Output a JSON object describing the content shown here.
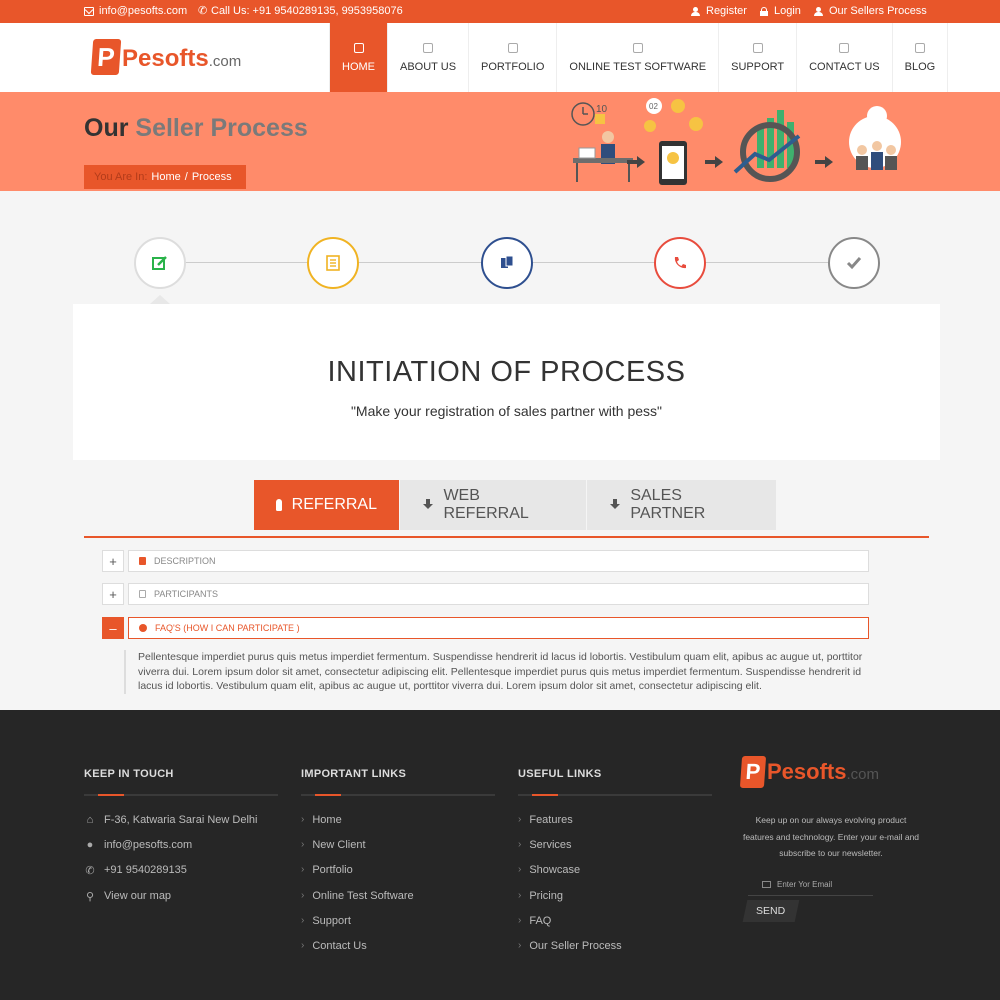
{
  "topbar": {
    "email": "info@pesofts.com",
    "call": "Call Us: +91 9540289135, 9953958076",
    "register": "Register",
    "login": "Login",
    "sellers": "Our Sellers Process"
  },
  "logo": {
    "mark": "P",
    "name": "Pesofts",
    "tld": ".com"
  },
  "nav": [
    "HOME",
    "ABOUT US",
    "PORTFOLIO",
    "ONLINE TEST SOFTWARE",
    "SUPPORT",
    "CONTACT US",
    "BLOG"
  ],
  "banner": {
    "title_a": "Our",
    "title_b": "Seller Process",
    "crumb_label": "You Are In:",
    "crumb_home": "Home",
    "crumb_sep": "/",
    "crumb_current": "Process",
    "illus_num1": "10",
    "illus_num2": "02"
  },
  "steps": [
    {
      "icon": "edit-icon",
      "color": "#2ab34a"
    },
    {
      "icon": "list-icon",
      "color": "#f0b322"
    },
    {
      "icon": "copy-icon",
      "color": "#2e4f8f"
    },
    {
      "icon": "phone-icon",
      "color": "#e84c3d"
    },
    {
      "icon": "check-icon",
      "color": "#888888"
    }
  ],
  "card": {
    "title": "INITIATION OF PROCESS",
    "subtitle": "\"Make your registration of sales partner with pess\""
  },
  "tabs": [
    "REFERRAL",
    "WEB REFERRAL",
    "SALES PARTNER"
  ],
  "accordion": [
    {
      "label": "DESCRIPTION",
      "toggle": "+"
    },
    {
      "label": "PARTICIPANTS",
      "toggle": "+"
    },
    {
      "label": "FAQ'S (HOW I CAN PARTICIPATE )",
      "toggle": "–"
    }
  ],
  "accordion_body": "Pellentesque imperdiet purus quis metus imperdiet fermentum. Suspendisse hendrerit id lacus id lobortis. Vestibulum quam elit, apibus ac augue ut, porttitor viverra dui. Lorem ipsum dolor sit amet, consectetur adipiscing elit. Pellentesque imperdiet purus quis metus imperdiet fermentum. Suspendisse hendrerit id lacus id lobortis. Vestibulum quam elit, apibus ac augue ut, porttitor viverra dui. Lorem ipsum dolor sit amet, consectetur adipiscing elit.",
  "footer": {
    "keep": {
      "title": "KEEP IN TOUCH",
      "address": "F-36, Katwaria Sarai New Delhi",
      "email": "info@pesofts.com",
      "phone": "+91 9540289135",
      "map": "View our map"
    },
    "important": {
      "title": "IMPORTANT LINKS",
      "links": [
        "Home",
        "New Client",
        "Portfolio",
        "Online Test Software",
        "Support",
        "Contact Us"
      ]
    },
    "useful": {
      "title": "USEFUL LINKS",
      "links": [
        "Features",
        "Services",
        "Showcase",
        "Pricing",
        "FAQ",
        "Our Seller Process"
      ]
    },
    "newsletter": {
      "text": "Keep up on our always evolving product features and technology. Enter your e-mail and subscribe to our newsletter.",
      "placeholder": "Enter Yor Email",
      "send": "SEND"
    }
  },
  "colors": {
    "accent": "#e8562a",
    "banner": "#ff8b6a",
    "footer": "#262626"
  }
}
